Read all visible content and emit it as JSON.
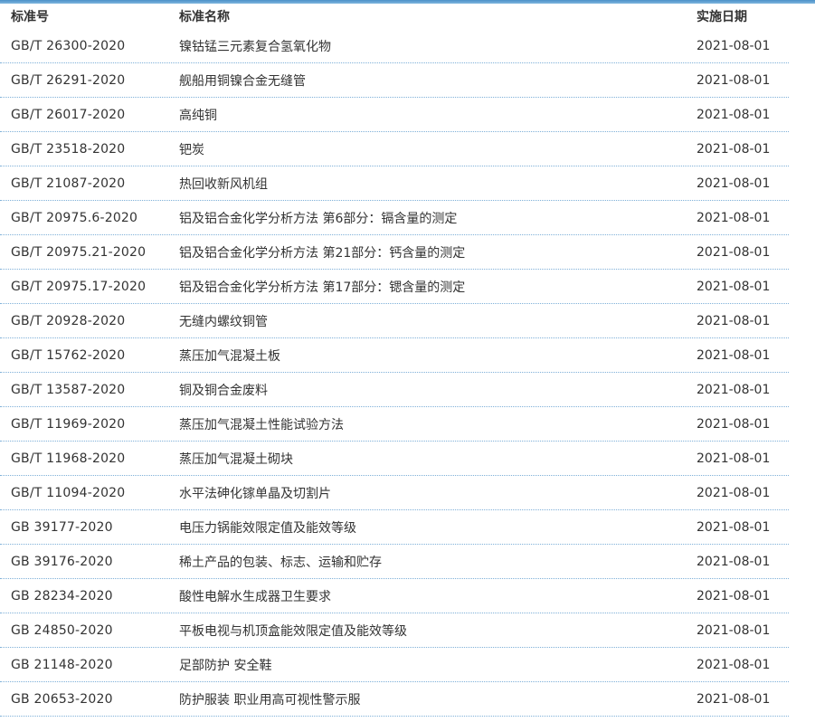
{
  "header": {
    "col_number": "标准号",
    "col_name": "标准名称",
    "col_date": "实施日期"
  },
  "rows": [
    {
      "number": "GB/T 26300-2020",
      "name": "镍钴锰三元素复合氢氧化物",
      "date": "2021-08-01"
    },
    {
      "number": "GB/T 26291-2020",
      "name": "舰船用铜镍合金无缝管",
      "date": "2021-08-01"
    },
    {
      "number": "GB/T 26017-2020",
      "name": "高纯铜",
      "date": "2021-08-01"
    },
    {
      "number": "GB/T 23518-2020",
      "name": "钯炭",
      "date": "2021-08-01"
    },
    {
      "number": "GB/T 21087-2020",
      "name": "热回收新风机组",
      "date": "2021-08-01"
    },
    {
      "number": "GB/T 20975.6-2020",
      "name": "铝及铝合金化学分析方法 第6部分：镉含量的测定",
      "date": "2021-08-01"
    },
    {
      "number": "GB/T 20975.21-2020",
      "name": "铝及铝合金化学分析方法 第21部分：钙含量的测定",
      "date": "2021-08-01"
    },
    {
      "number": "GB/T 20975.17-2020",
      "name": "铝及铝合金化学分析方法 第17部分：锶含量的测定",
      "date": "2021-08-01"
    },
    {
      "number": "GB/T 20928-2020",
      "name": "无缝内螺纹铜管",
      "date": "2021-08-01"
    },
    {
      "number": "GB/T 15762-2020",
      "name": "蒸压加气混凝土板",
      "date": "2021-08-01"
    },
    {
      "number": "GB/T 13587-2020",
      "name": "铜及铜合金废料",
      "date": "2021-08-01"
    },
    {
      "number": "GB/T 11969-2020",
      "name": "蒸压加气混凝土性能试验方法",
      "date": "2021-08-01"
    },
    {
      "number": "GB/T 11968-2020",
      "name": "蒸压加气混凝土砌块",
      "date": "2021-08-01"
    },
    {
      "number": "GB/T 11094-2020",
      "name": "水平法砷化镓单晶及切割片",
      "date": "2021-08-01"
    },
    {
      "number": "GB 39177-2020",
      "name": "电压力锅能效限定值及能效等级",
      "date": "2021-08-01"
    },
    {
      "number": "GB 39176-2020",
      "name": "稀土产品的包装、标志、运输和贮存",
      "date": "2021-08-01"
    },
    {
      "number": "GB 28234-2020",
      "name": "酸性电解水生成器卫生要求",
      "date": "2021-08-01"
    },
    {
      "number": "GB 24850-2020",
      "name": "平板电视与机顶盒能效限定值及能效等级",
      "date": "2021-08-01"
    },
    {
      "number": "GB 21148-2020",
      "name": "足部防护 安全鞋",
      "date": "2021-08-01"
    },
    {
      "number": "GB 20653-2020",
      "name": "防护服装 职业用高可视性警示服",
      "date": "2021-08-01"
    }
  ]
}
